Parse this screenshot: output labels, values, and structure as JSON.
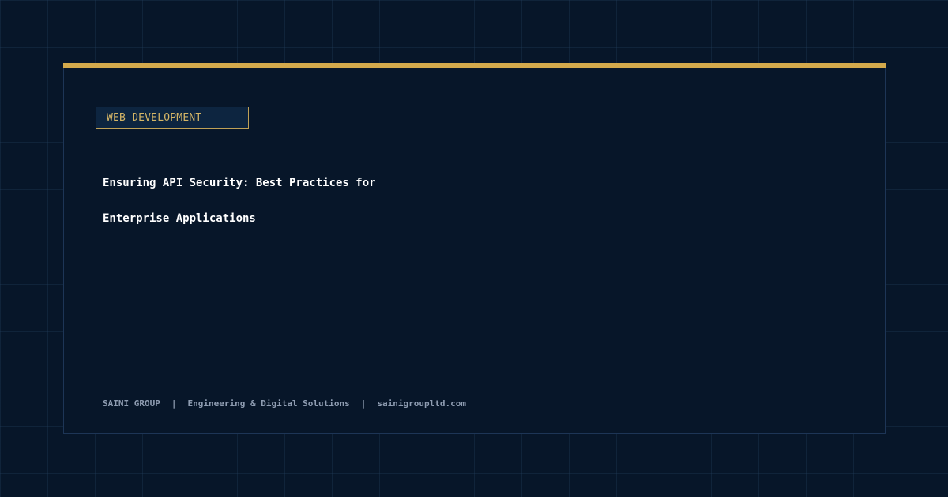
{
  "colors": {
    "background": "#071629",
    "accent": "#d4aa4c",
    "tag_text": "#d4b566",
    "title_text": "#ffffff",
    "footer_text": "#8f9db2"
  },
  "card": {
    "category": "WEB DEVELOPMENT",
    "title_lines": [
      "Ensuring API Security: Best Practices for",
      "Enterprise Applications"
    ]
  },
  "footer": {
    "company": "SAINI GROUP",
    "separator": "|",
    "tagline": "Engineering & Digital Solutions",
    "website": "sainigroupltd.com"
  }
}
